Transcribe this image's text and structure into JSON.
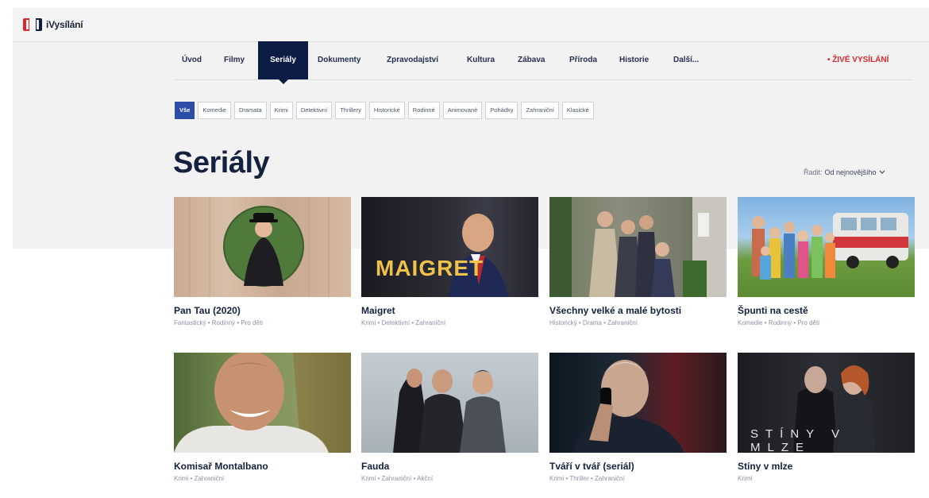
{
  "app": {
    "logo_text": "iVysílání"
  },
  "nav": {
    "items": [
      "Úvod",
      "Filmy",
      "Seriály",
      "Dokumenty",
      "Zpravodajství",
      "Kultura",
      "Zábava",
      "Příroda",
      "Historie",
      "Další..."
    ],
    "active": "Seriály",
    "live_label": "• ŽIVÉ VYSÍLÁNÍ"
  },
  "chips": [
    "Vše",
    "Komedie",
    "Dramata",
    "Krimi",
    "Detektivní",
    "Thrillery",
    "Historické",
    "Rodinné",
    "Animované",
    "Pohádky",
    "Zahraniční",
    "Klasické"
  ],
  "page": {
    "title": "Seriály"
  },
  "sort": {
    "label": "Řadit:",
    "value": "Od nejnovějšího"
  },
  "cards": [
    {
      "title": "Pan Tau (2020)",
      "meta": "Fantastický • Rodinný • Pro děti",
      "thumb_text": ""
    },
    {
      "title": "Maigret",
      "meta": "Krimi • Detektivní • Zahraniční",
      "thumb_text": "MAIGRET"
    },
    {
      "title": "Všechny velké a malé bytosti",
      "meta": "Historický • Drama • Zahraniční",
      "thumb_text": ""
    },
    {
      "title": "Špunti na cestě",
      "meta": "Komedie • Rodinný • Pro děti",
      "thumb_text": ""
    },
    {
      "title": "Komisař Montalbano",
      "meta": "Krimi • Zahraniční",
      "thumb_text": ""
    },
    {
      "title": "Fauda",
      "meta": "Krimi • Zahraniční • Akční",
      "thumb_text": ""
    },
    {
      "title": "Tváří v tvář (seriál)",
      "meta": "Krimi • Thriller • Zahraniční",
      "thumb_text": ""
    },
    {
      "title": "Stíny v mlze",
      "meta": "Krimi",
      "thumb_text": "STÍNY V MLZE"
    }
  ],
  "colors": {
    "brand_red": "#e0262b",
    "brand_navy": "#0d1c45",
    "chip_active": "#2c4ea8"
  }
}
